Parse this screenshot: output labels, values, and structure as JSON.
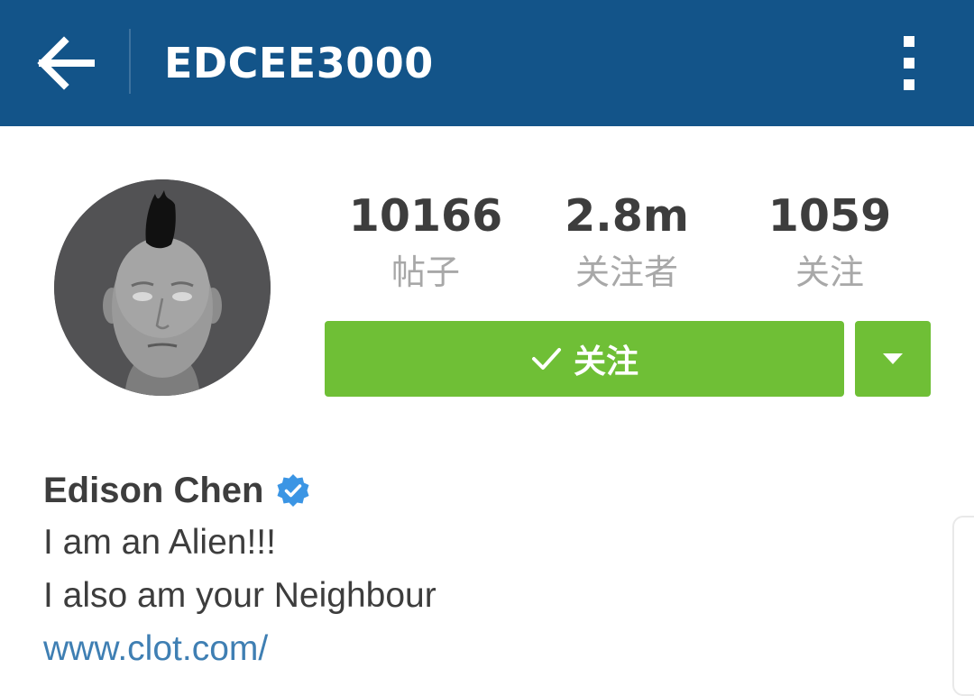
{
  "app": {
    "header": {
      "username": "EDCEE3000",
      "back_icon": "arrow-left-icon",
      "menu_icon": "more-vertical-icon"
    },
    "profile": {
      "avatar_icon": "avatar",
      "stats": [
        {
          "value": "10166",
          "label": "帖子"
        },
        {
          "value": "2.8m",
          "label": "关注者"
        },
        {
          "value": "1059",
          "label": "关注"
        }
      ],
      "follow_button": {
        "label": "关注",
        "icon": "checkmark-icon"
      },
      "dropdown_icon": "caret-down-icon"
    },
    "bio": {
      "name": "Edison Chen",
      "verified_icon": "verified-badge-icon",
      "lines": [
        "I am an Alien!!!",
        "I also am your Neighbour"
      ],
      "link": "www.clot.com/"
    }
  },
  "colors": {
    "header_bg": "#135489",
    "follow_green": "#6fbf36",
    "link_blue": "#3f7fb3",
    "verified_blue": "#3b95e4",
    "text_dark": "#3d3d3d",
    "text_muted": "#a8a8a8"
  }
}
